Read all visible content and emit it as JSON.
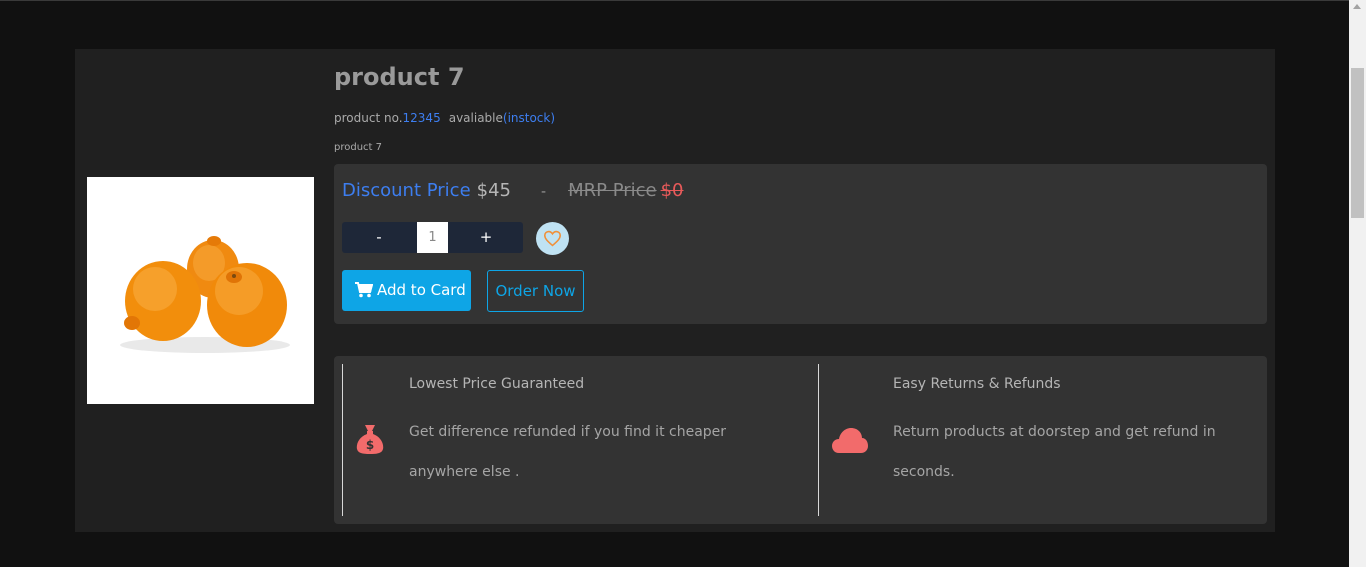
{
  "product": {
    "title": "product 7",
    "number_label": "product no.",
    "number_value": "12345",
    "availability_label": "avaliable",
    "availability_value": "(instock)",
    "description": "product 7",
    "image_alt": "oranges"
  },
  "pricing": {
    "discount_label": "Discount Price",
    "discount_value": "$45",
    "separator": "-",
    "mrp_label": "MRP Price",
    "mrp_value": "$0"
  },
  "quantity": {
    "minus_label": "-",
    "value": "1",
    "plus_label": "+"
  },
  "actions": {
    "add_to_cart_label": "Add to Card",
    "order_now_label": "Order Now",
    "wishlist_icon": "heart-icon",
    "cart_icon": "cart-icon"
  },
  "features": [
    {
      "icon": "money-bag-icon",
      "title": "Lowest Price Guaranteed",
      "text": "Get difference refunded if you find it cheaper anywhere else ."
    },
    {
      "icon": "cloud-icon",
      "title": "Easy Returns & Refunds",
      "text": "Return products at doorstep and get refund in seconds."
    }
  ],
  "colors": {
    "page_background": "#111111",
    "card_background": "#202020",
    "panel_background": "#333333",
    "accent_blue": "#3d7ef0",
    "button_blue": "#0ea5e6",
    "mrp_red": "#e85a5a",
    "icon_coral": "#f26b6b"
  }
}
